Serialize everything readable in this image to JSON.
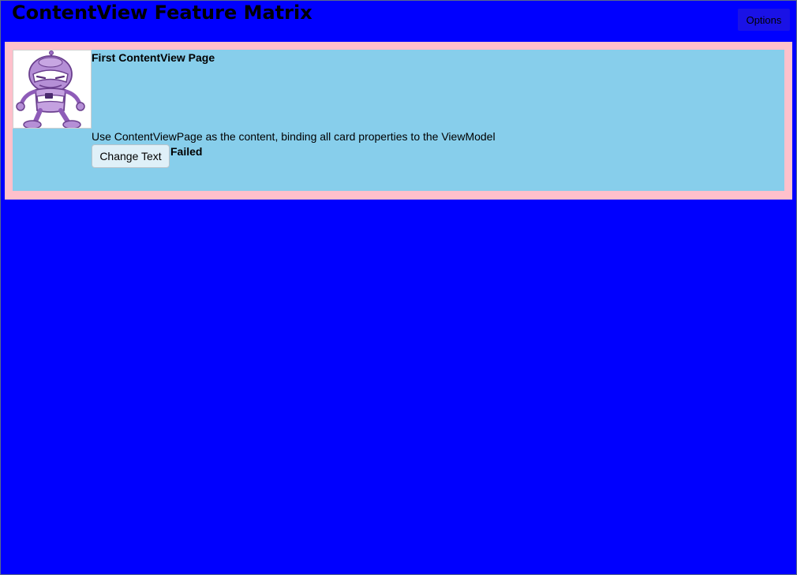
{
  "page": {
    "title": "ContentView Feature Matrix",
    "background_color": "#0000FF"
  },
  "toolbar": {
    "options_label": "Options"
  },
  "card": {
    "border_color": "#FFC0CB",
    "background_color": "#87CEEB",
    "image_icon": "dotnet-bot-robot-icon",
    "title": "First ContentView Page",
    "description": "Use ContentViewPage as the content, binding all card properties to the ViewModel",
    "change_text_label": "Change Text",
    "status": "Failed"
  }
}
